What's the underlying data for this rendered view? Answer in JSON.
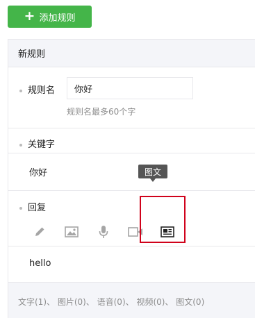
{
  "toolbar": {
    "add_rule_label": "添加规则"
  },
  "rule": {
    "header_title": "新规则",
    "name_label": "规则名",
    "name_value": "你好",
    "name_hint": "规则名最多60个字",
    "keyword_label": "关键字",
    "keyword_value": "你好",
    "reply_label": "回复",
    "reply_value": "hello",
    "reply_tools": [
      {
        "icon": "pencil-icon",
        "label": "文字"
      },
      {
        "icon": "image-icon",
        "label": "图片"
      },
      {
        "icon": "microphone-icon",
        "label": "语音"
      },
      {
        "icon": "video-icon",
        "label": "视频"
      },
      {
        "icon": "news-icon",
        "label": "图文"
      }
    ],
    "tooltip_text": "图文",
    "stats_text": "文字(1)、 图片(0)、 语音(0)、 视频(0)、 图文(0)"
  },
  "colors": {
    "accent_green": "#44b549",
    "highlight_red": "#d0021b",
    "panel_bg": "#f4f5f9",
    "border": "#e7e7eb"
  }
}
